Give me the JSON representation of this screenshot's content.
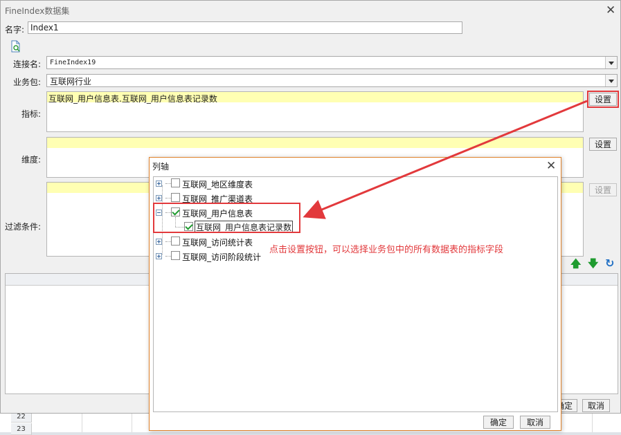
{
  "dialog": {
    "title": "FineIndex数据集",
    "name_label": "名字:",
    "name_value": "Index1",
    "connection_label": "连接名:",
    "connection_value": "FineIndex19",
    "package_label": "业务包:",
    "package_value": "互联网行业",
    "metric_label": "指标:",
    "metric_value": "互联网_用户信息表.互联网_用户信息表记录数",
    "dimension_label": "维度:",
    "filter_label": "过滤条件:",
    "set_button": "设置",
    "ok_button": "确定",
    "cancel_button": "取消"
  },
  "popup": {
    "title": "列轴",
    "tree": [
      {
        "label": "互联网_地区维度表",
        "expanded": false,
        "checked": false
      },
      {
        "label": "互联网_推广渠道表",
        "expanded": false,
        "checked": false
      },
      {
        "label": "互联网_用户信息表",
        "expanded": true,
        "checked": true,
        "children": [
          {
            "label": "互联网_用户信息表记录数",
            "checked": true
          }
        ]
      },
      {
        "label": "互联网_访问统计表",
        "expanded": false,
        "checked": false
      },
      {
        "label": "互联网_访问阶段统计",
        "expanded": false,
        "checked": false
      }
    ],
    "ok_button": "确定",
    "cancel_button": "取消"
  },
  "annotation": {
    "text": "点击设置按钮，可以选择业务包中的所有数据表的指标字段",
    "color": "#e2393c"
  },
  "background": {
    "row_numbers": [
      "22",
      "23"
    ]
  },
  "colors": {
    "highlight": "#ffffb3",
    "popup_border": "#e0822a",
    "arrow_green": "#1f9b2f",
    "refresh_blue": "#1f6fc4"
  },
  "icons": {
    "preview": "preview-icon",
    "move_up": "arrow-up-icon",
    "move_down": "arrow-down-icon",
    "refresh": "refresh-icon",
    "close": "close-icon"
  }
}
